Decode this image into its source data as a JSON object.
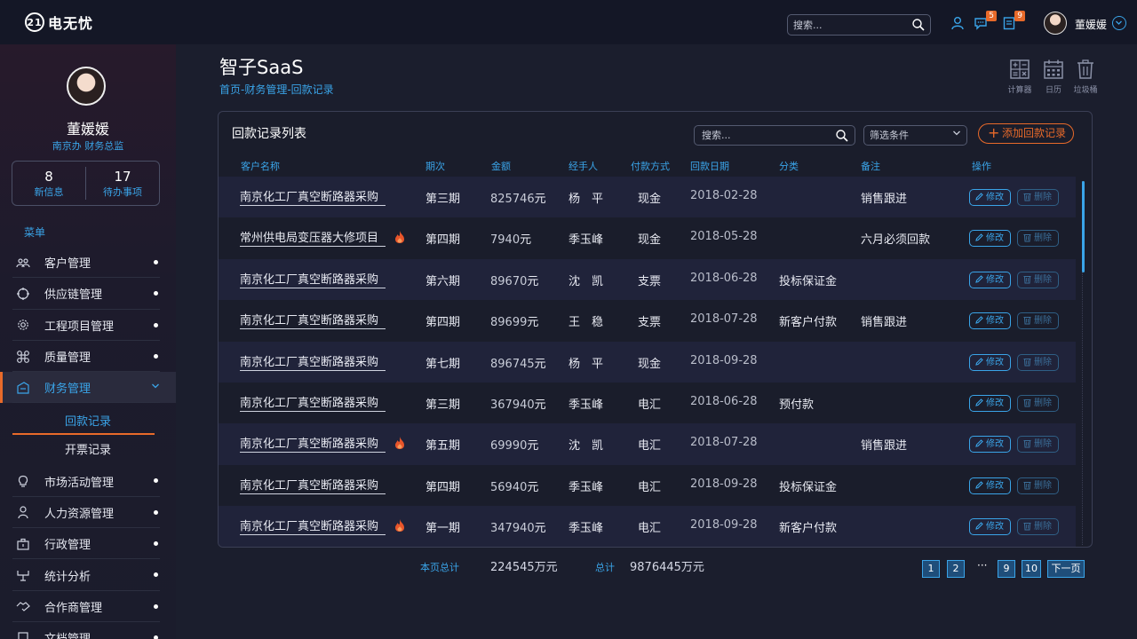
{
  "app": {
    "logo_text": "电无忧",
    "logo_mark": "21"
  },
  "topbar": {
    "search_placeholder": "搜索...",
    "messages_badge": "5",
    "tasks_badge": "9",
    "user_name": "董媛媛"
  },
  "sidebar": {
    "name": "董媛媛",
    "role": "南京办  财务总监",
    "stats": [
      {
        "value": "8",
        "label": "新信息"
      },
      {
        "value": "17",
        "label": "待办事项"
      }
    ],
    "menu_title": "菜单",
    "items_top": [
      {
        "label": "客户管理",
        "icon": "customers-icon"
      },
      {
        "label": "供应链管理",
        "icon": "supply-chain-icon"
      },
      {
        "label": "工程项目管理",
        "icon": "gear-icon"
      },
      {
        "label": "质量管理",
        "icon": "quality-icon"
      }
    ],
    "active_item": {
      "label": "财务管理",
      "icon": "finance-icon"
    },
    "sub_items": [
      {
        "label": "回款记录"
      },
      {
        "label": "开票记录"
      }
    ],
    "items_bottom": [
      {
        "label": "市场活动管理",
        "icon": "lightbulb-icon"
      },
      {
        "label": "人力资源管理",
        "icon": "person-icon"
      },
      {
        "label": "行政管理",
        "icon": "briefcase-icon"
      },
      {
        "label": "统计分析",
        "icon": "chart-icon"
      },
      {
        "label": "合作商管理",
        "icon": "handshake-icon"
      },
      {
        "label": "文档管理",
        "icon": "document-icon"
      }
    ]
  },
  "header": {
    "title": "智子SaaS",
    "breadcrumb": "首页-财务管理-回款记录",
    "tools": [
      {
        "label": "计算器",
        "icon": "calculator-icon"
      },
      {
        "label": "日历",
        "icon": "calendar-icon"
      },
      {
        "label": "垃圾桶",
        "icon": "trash-icon"
      }
    ]
  },
  "panel": {
    "title": "回款记录列表",
    "search_placeholder": "搜索...",
    "filter_label": "筛选条件",
    "add_label": "添加回款记录",
    "columns": [
      "客户名称",
      "期次",
      "金额",
      "经手人",
      "付款方式",
      "回款日期",
      "分类",
      "备注",
      "操作"
    ],
    "edit_label": "修改",
    "delete_label": "删除",
    "amount_unit": "元",
    "rows": [
      {
        "client": "南京化工厂真空断路器采购",
        "period": "第三期",
        "amount": "825746",
        "handler": "杨　平",
        "method": "现金",
        "date": "2018-02-28",
        "category": "",
        "note": "销售跟进",
        "hot": false
      },
      {
        "client": "常州供电局变压器大修项目",
        "period": "第四期",
        "amount": "7940",
        "handler": "季玉峰",
        "method": "现金",
        "date": "2018-05-28",
        "category": "",
        "note": "六月必须回款",
        "hot": true
      },
      {
        "client": "南京化工厂真空断路器采购",
        "period": "第六期",
        "amount": "89670",
        "handler": "沈　凯",
        "method": "支票",
        "date": "2018-06-28",
        "category": "投标保证金",
        "note": "",
        "hot": false
      },
      {
        "client": "南京化工厂真空断路器采购",
        "period": "第四期",
        "amount": "89699",
        "handler": "王　稳",
        "method": "支票",
        "date": "2018-07-28",
        "category": "新客户付款",
        "note": "销售跟进",
        "hot": false
      },
      {
        "client": "南京化工厂真空断路器采购",
        "period": "第七期",
        "amount": "896745",
        "handler": "杨　平",
        "method": "现金",
        "date": "2018-09-28",
        "category": "",
        "note": "",
        "hot": false
      },
      {
        "client": "南京化工厂真空断路器采购",
        "period": "第三期",
        "amount": "367940",
        "handler": "季玉峰",
        "method": "电汇",
        "date": "2018-06-28",
        "category": "预付款",
        "note": "",
        "hot": false
      },
      {
        "client": "南京化工厂真空断路器采购",
        "period": "第五期",
        "amount": "69990",
        "handler": "沈　凯",
        "method": "电汇",
        "date": "2018-07-28",
        "category": "",
        "note": "销售跟进",
        "hot": true
      },
      {
        "client": "南京化工厂真空断路器采购",
        "period": "第四期",
        "amount": "56940",
        "handler": "季玉峰",
        "method": "电汇",
        "date": "2018-09-28",
        "category": "投标保证金",
        "note": "",
        "hot": false
      },
      {
        "client": "南京化工厂真空断路器采购",
        "period": "第一期",
        "amount": "347940",
        "handler": "季玉峰",
        "method": "电汇",
        "date": "2018-09-28",
        "category": "新客户付款",
        "note": "",
        "hot": true
      }
    ]
  },
  "footer": {
    "page_total_label": "本页总计",
    "page_total_value": "224545万元",
    "total_label": "总计",
    "total_value": "9876445万元",
    "pages": [
      "1",
      "2",
      "9",
      "10"
    ],
    "dots": "···",
    "next_label": "下一页"
  },
  "colors": {
    "accent": "#3aa4e8",
    "orange": "#e86a2a",
    "bg": "#1b1e2d"
  }
}
